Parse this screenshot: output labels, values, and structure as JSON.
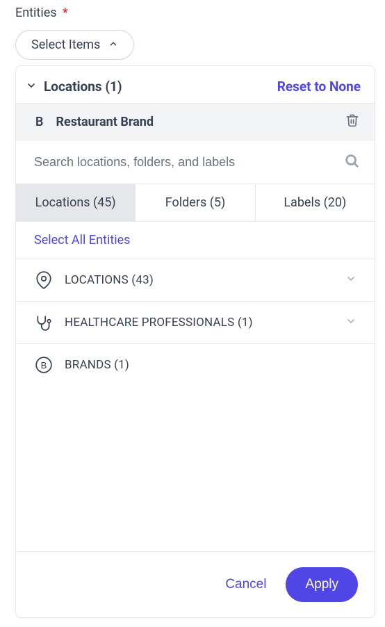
{
  "field": {
    "label": "Entities",
    "required_marker": "*"
  },
  "trigger": {
    "label": "Select Items"
  },
  "panel": {
    "title": "Locations (1)",
    "reset_label": "Reset to None"
  },
  "selected": {
    "badge": "B",
    "name": "Restaurant Brand"
  },
  "search": {
    "placeholder": "Search locations, folders, and labels"
  },
  "tabs": [
    {
      "label": "Locations (45)"
    },
    {
      "label": "Folders (5)"
    },
    {
      "label": "Labels (20)"
    }
  ],
  "select_all_label": "Select All Entities",
  "categories": [
    {
      "label": "LOCATIONS (43)",
      "expandable": true
    },
    {
      "label": "HEALTHCARE PROFESSIONALS (1)",
      "expandable": true
    },
    {
      "label": "BRANDS (1)",
      "expandable": false
    }
  ],
  "footer": {
    "cancel": "Cancel",
    "apply": "Apply"
  },
  "colors": {
    "accent": "#4f46e5",
    "danger": "#dc2626"
  }
}
